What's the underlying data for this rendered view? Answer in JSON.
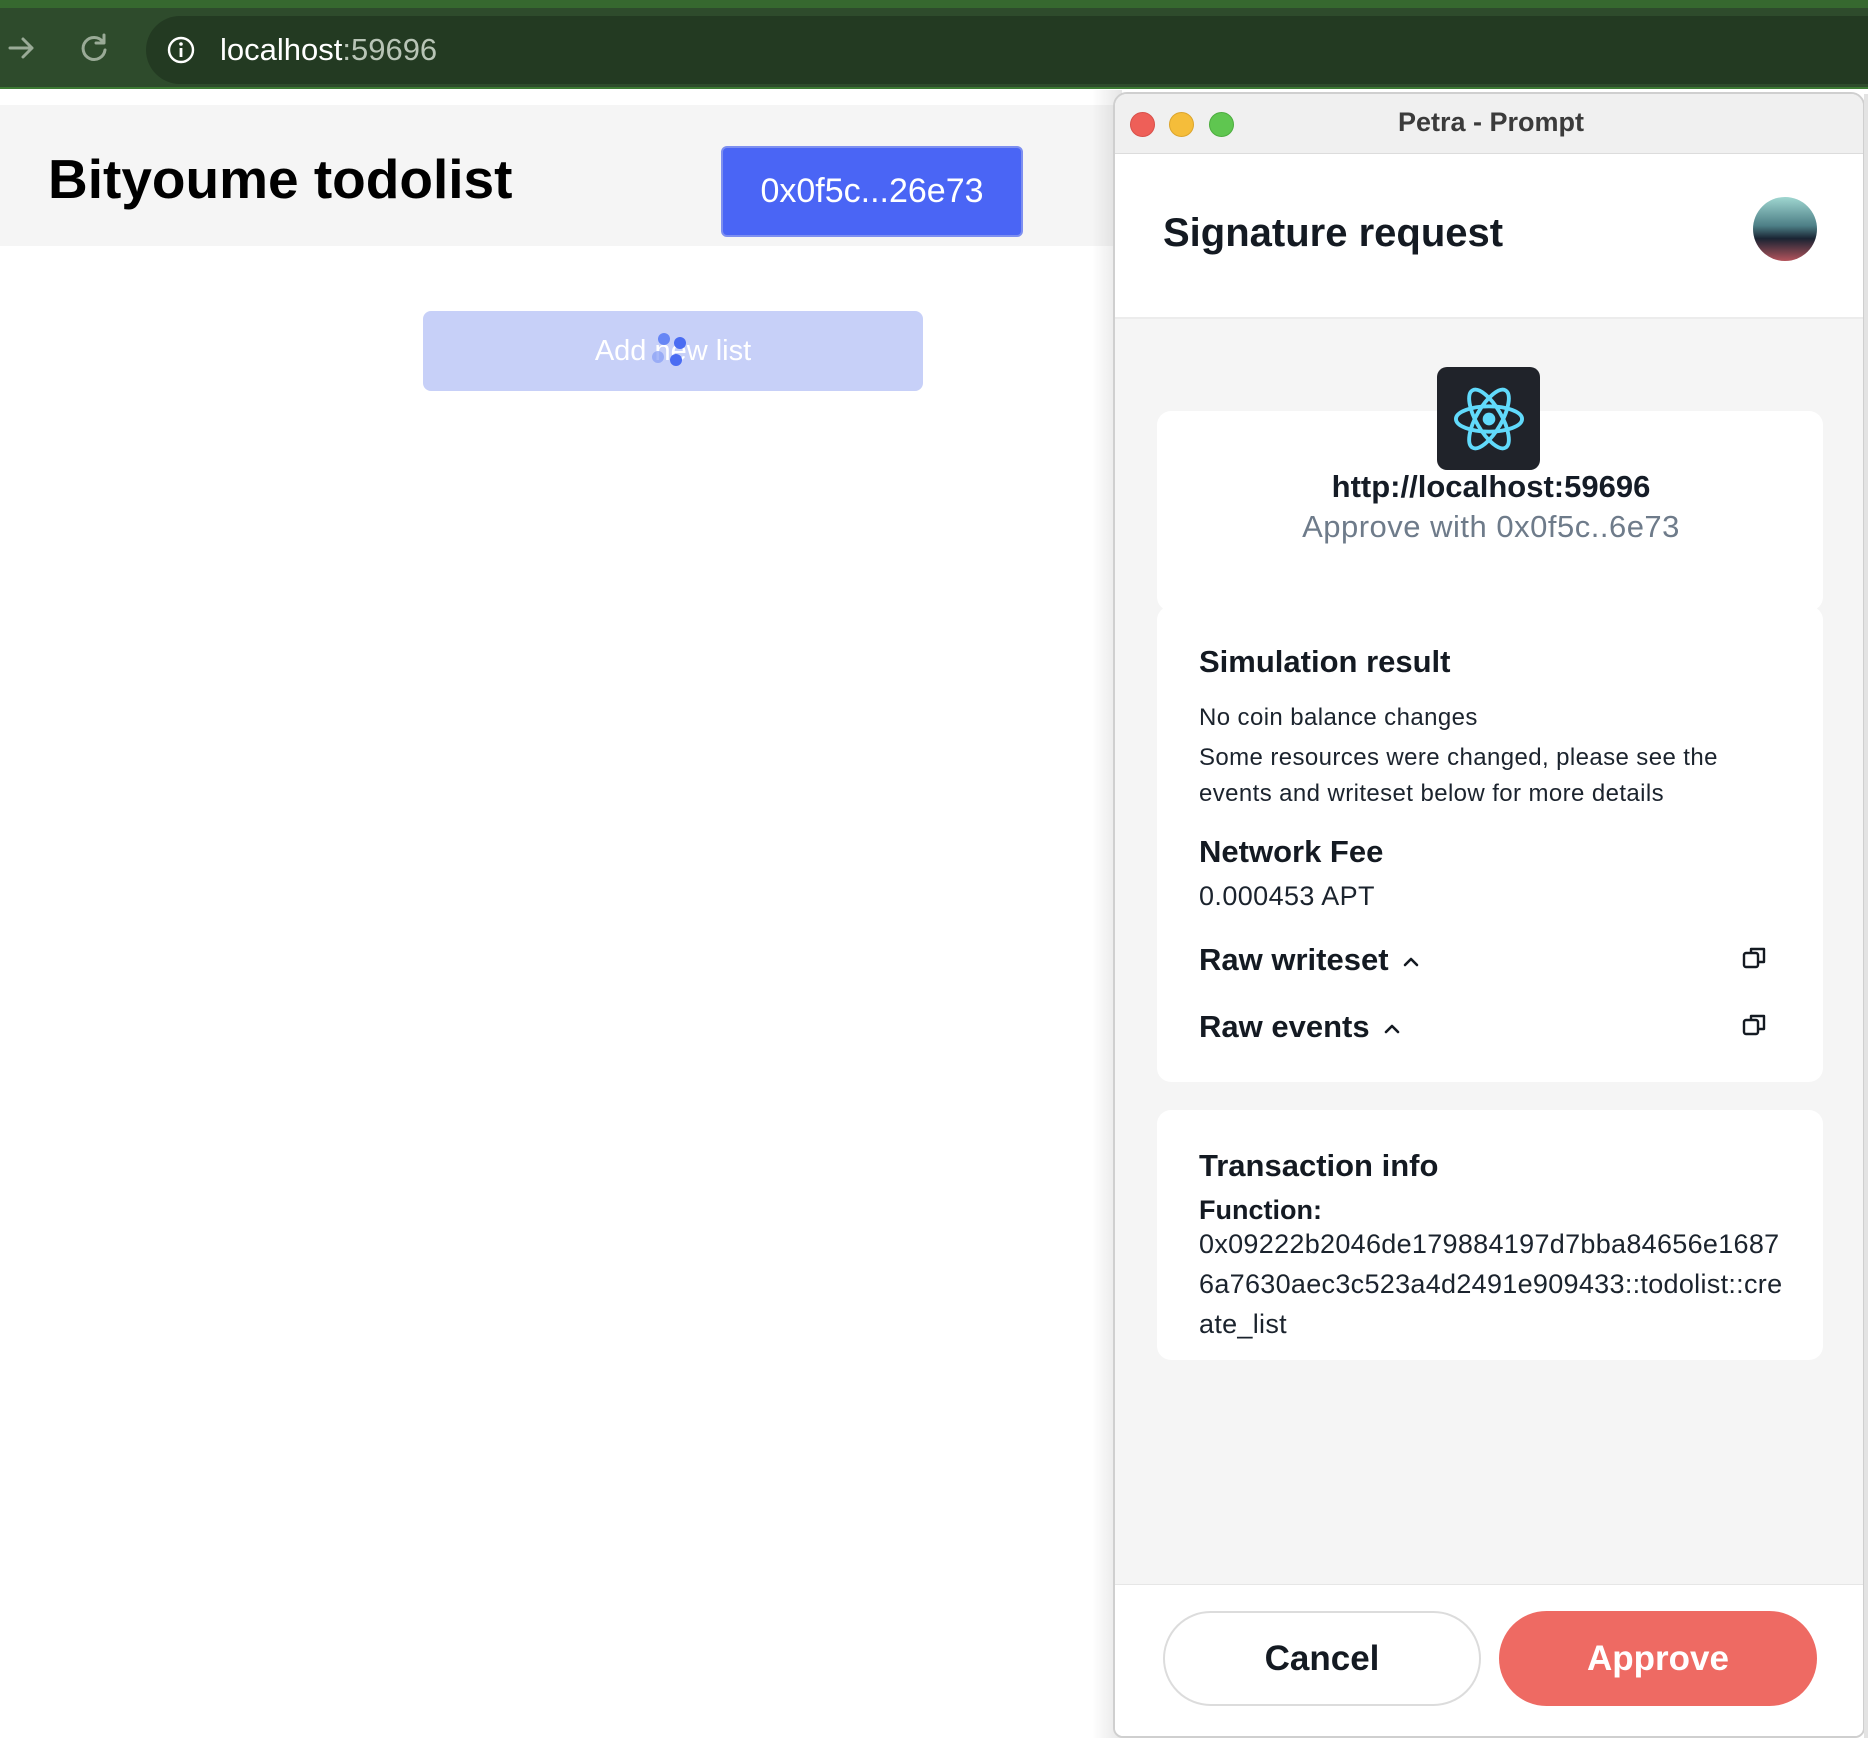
{
  "browser": {
    "url_host": "localhost",
    "url_port": ":59696"
  },
  "app": {
    "title": "Bityoume todolist",
    "wallet_button_label": "0x0f5c...26e73",
    "add_list_label": "Add new list"
  },
  "popup": {
    "window_title": "Petra - Prompt",
    "heading": "Signature request",
    "dapp": {
      "url": "http://localhost:59696",
      "approve_with": "Approve with 0x0f5c..6e73",
      "icon": "react-logo-icon"
    },
    "simulation": {
      "heading": "Simulation result",
      "balance_text": "No coin balance changes",
      "resources_text": "Some resources were changed, please see the events and writeset below for more details",
      "fee_heading": "Network Fee",
      "fee_value": "0.000453 APT",
      "raw_writeset_label": "Raw writeset",
      "raw_events_label": "Raw events"
    },
    "transaction": {
      "heading": "Transaction info",
      "function_label": "Function:",
      "function_value": "0x09222b2046de179884197d7bba84656e16876a7630aec3c523a4d2491e909433::todolist::create_list"
    },
    "footer": {
      "cancel_label": "Cancel",
      "approve_label": "Approve"
    }
  },
  "colors": {
    "browser_bar": "#2e4b2c",
    "wallet_button": "#4a65f5",
    "add_list_button": "#c7d0f8",
    "approve_button": "#ee6a63"
  }
}
